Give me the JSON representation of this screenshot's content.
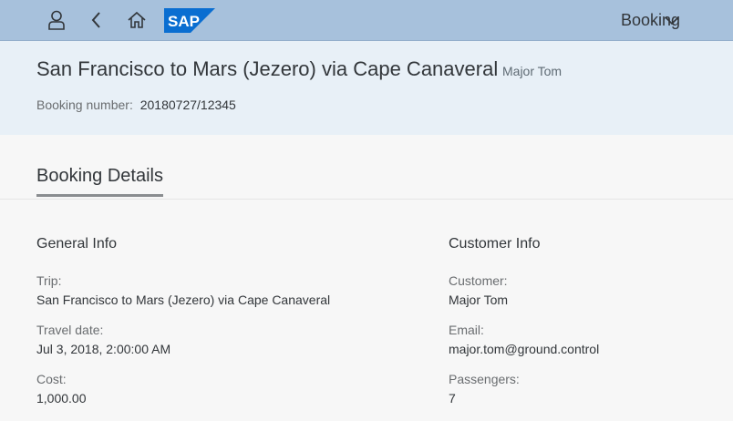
{
  "shell": {
    "logo_text": "SAP",
    "title": "Booking",
    "icons": [
      "user-icon",
      "back-icon",
      "home-icon",
      "chevron-down-icon"
    ]
  },
  "header": {
    "title": "San Francisco to Mars (Jezero) via Cape Canaveral",
    "subtitle": "Major Tom",
    "booking_number_label": "Booking number:",
    "booking_number": "20180727/12345"
  },
  "section": {
    "tab_label": "Booking Details"
  },
  "general_info": {
    "title": "General Info",
    "trip_label": "Trip:",
    "trip": "San Francisco to Mars (Jezero) via Cape Canaveral",
    "travel_date_label": "Travel date:",
    "travel_date": "Jul 3, 2018, 2:00:00 AM",
    "cost_label": "Cost:",
    "cost": "1,000.00"
  },
  "customer_info": {
    "title": "Customer Info",
    "customer_label": "Customer:",
    "customer": "Major Tom",
    "email_label": "Email:",
    "email": "major.tom@ground.control",
    "passengers_label": "Passengers:",
    "passengers": "7"
  },
  "colors": {
    "shellbar": "#a7c1dc",
    "header_bg": "#e8f0f7",
    "logo_blue": "#0a6ed1"
  }
}
